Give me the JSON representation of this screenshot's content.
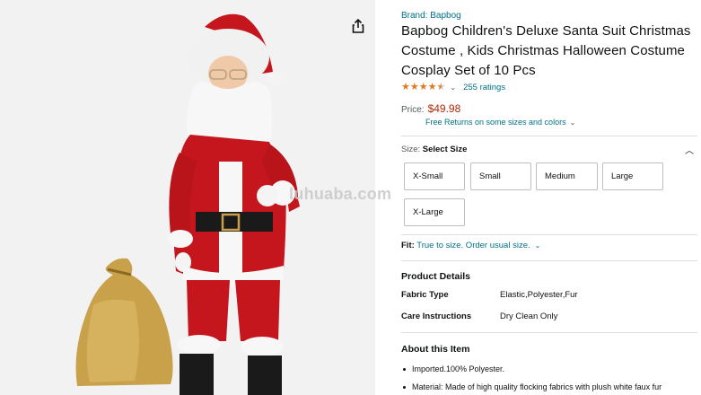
{
  "image_panel": {
    "share_icon": "share-icon",
    "watermark": "luhuaba.com"
  },
  "product": {
    "brand": "Brand: Bapbog",
    "title": "Bapbog Children's Deluxe Santa Suit Christmas Costume , Kids Christmas Halloween Costume Cosplay Set of 10 Pcs",
    "rating_stars": 4.5,
    "rating_count": "255 ratings",
    "price_label": "Price:",
    "price": "$49.98",
    "returns": "Free Returns on some sizes and colors"
  },
  "size": {
    "label": "Size:",
    "selected": "Select Size",
    "options": [
      "X-Small",
      "Small",
      "Medium",
      "Large",
      "X-Large"
    ]
  },
  "fit": {
    "label": "Fit:",
    "value": "True to size. Order usual size."
  },
  "details": {
    "title": "Product Details",
    "rows": [
      {
        "label": "Fabric Type",
        "value": "Elastic,Polyester,Fur"
      },
      {
        "label": "Care Instructions",
        "value": "Dry Clean Only"
      }
    ]
  },
  "about": {
    "title": "About this Item",
    "bullets": [
      "Imported.100% Polyester.",
      "Material: Made of high quality flocking fabrics with plush white faux fur"
    ]
  },
  "colors": {
    "link": "#007185",
    "price": "#b12704",
    "star": "#de7921",
    "santa_red": "#c4161c"
  }
}
